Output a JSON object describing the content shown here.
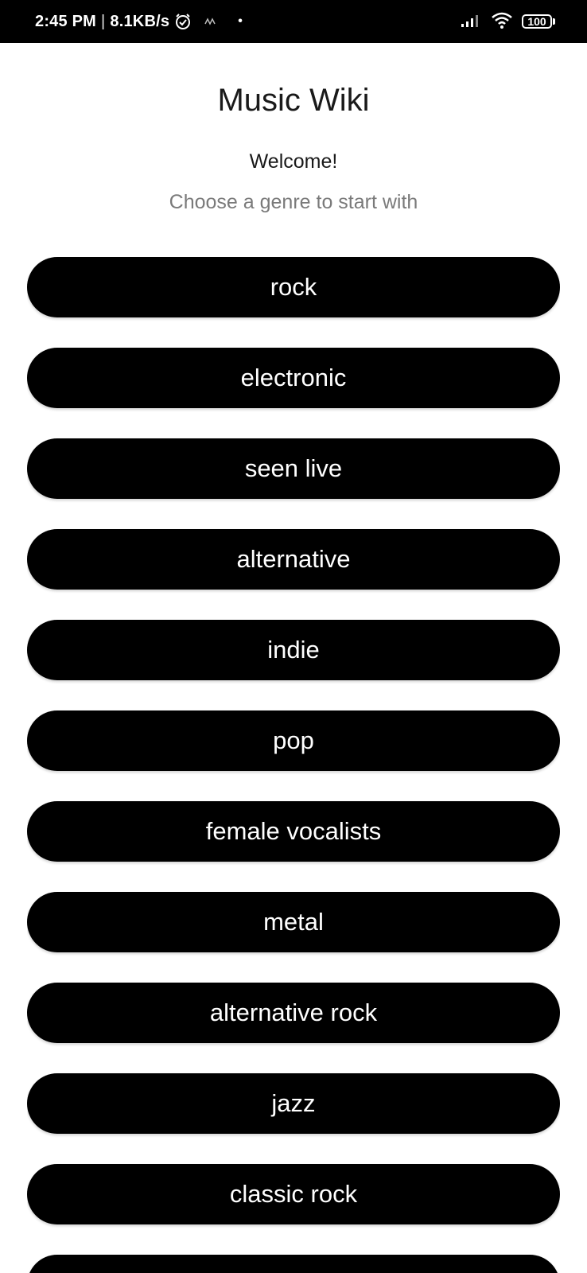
{
  "status_bar": {
    "time": "2:45 PM",
    "separator": "|",
    "net_speed": "8.1KB/s",
    "dot": "•",
    "battery": "100",
    "icons": [
      "alarm-icon",
      "notification-icon",
      "signal-icon",
      "wifi-icon",
      "battery-icon"
    ]
  },
  "header": {
    "title": "Music Wiki",
    "welcome": "Welcome!",
    "subtitle": "Choose a genre to start with"
  },
  "genres": [
    {
      "label": "rock"
    },
    {
      "label": "electronic"
    },
    {
      "label": "seen live"
    },
    {
      "label": "alternative"
    },
    {
      "label": "indie"
    },
    {
      "label": "pop"
    },
    {
      "label": "female vocalists"
    },
    {
      "label": "metal"
    },
    {
      "label": "alternative rock"
    },
    {
      "label": "jazz"
    },
    {
      "label": "classic rock"
    },
    {
      "label": ""
    }
  ],
  "colors": {
    "button_bg": "#000000",
    "button_text": "#ffffff",
    "title_text": "#1a1a1a",
    "subtitle_text": "#7a7a7a",
    "status_bar_bg": "#000000"
  }
}
